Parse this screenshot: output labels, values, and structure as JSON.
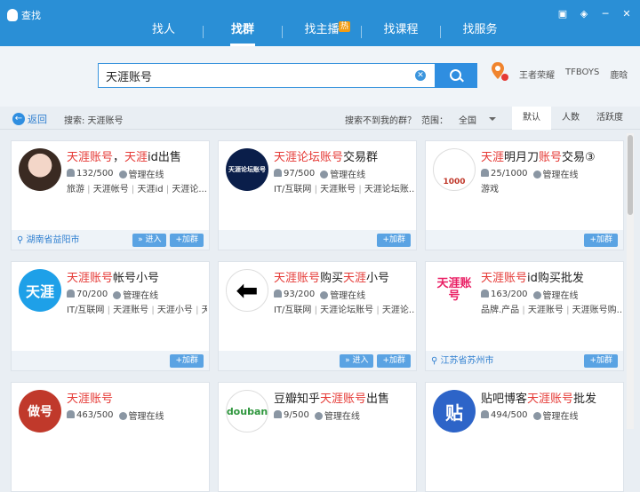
{
  "app": {
    "title": "查找"
  },
  "tabs": [
    {
      "label": "找人"
    },
    {
      "label": "找群"
    },
    {
      "label": "找主播",
      "badge": "热"
    },
    {
      "label": "找课程"
    },
    {
      "label": "找服务"
    }
  ],
  "search": {
    "value": "天涯账号",
    "hot_links": [
      "王者荣耀",
      "TFBOYS",
      "鹿晗"
    ]
  },
  "filter": {
    "back_label": "返回",
    "search_label": "搜索: 天涯账号",
    "notfound_label": "搜索不到我的群？",
    "range_label": "范围：",
    "range_value": "全国",
    "sort": [
      "默认",
      "人数",
      "活跃度"
    ]
  },
  "cards": [
    {
      "title_parts": [
        [
          "天涯账号",
          true
        ],
        [
          "，",
          false
        ],
        [
          "天涯",
          true
        ],
        [
          "id出售",
          false
        ]
      ],
      "members": "132/500",
      "admin": "管理在线",
      "tags": [
        "旅游",
        "天涯帐号",
        "天涯id",
        "天涯论..."
      ],
      "location": "湖南省益阳市",
      "enter": true,
      "avatar": "photo"
    },
    {
      "title_parts": [
        [
          "天涯论坛",
          true
        ],
        [
          "账号",
          true
        ],
        [
          "交易群",
          false
        ]
      ],
      "members": "97/500",
      "admin": "管理在线",
      "tags": [
        "IT/互联网",
        "天涯账号",
        "天涯论坛账..."
      ],
      "location": "",
      "enter": false,
      "avatar": "天涯论坛账号"
    },
    {
      "title_parts": [
        [
          "天涯",
          true
        ],
        [
          "明月刀",
          false
        ],
        [
          "账号",
          true
        ],
        [
          "交易③",
          false
        ]
      ],
      "members": "25/1000",
      "admin": "管理在线",
      "tags": [
        "游戏"
      ],
      "location": "",
      "enter": false,
      "avatar": "1000"
    },
    {
      "title_parts": [
        [
          "天涯账号",
          true
        ],
        [
          "帐号小号",
          false
        ]
      ],
      "members": "70/200",
      "admin": "管理在线",
      "tags": [
        "IT/互联网",
        "天涯账号",
        "天涯小号",
        "天涯..."
      ],
      "location": "",
      "enter": false,
      "avatar": "天涯"
    },
    {
      "title_parts": [
        [
          "天涯账号",
          true
        ],
        [
          "购买",
          false
        ],
        [
          "天涯",
          true
        ],
        [
          "小号",
          false
        ]
      ],
      "members": "93/200",
      "admin": "管理在线",
      "tags": [
        "IT/互联网",
        "天涯论坛账号",
        "天涯论..."
      ],
      "location": "",
      "enter": true,
      "avatar": "arrow"
    },
    {
      "title_parts": [
        [
          "天涯账号",
          true
        ],
        [
          "id购买批发",
          false
        ]
      ],
      "members": "163/200",
      "admin": "管理在线",
      "tags": [
        "品牌.产品",
        "天涯账号",
        "天涯账号购..."
      ],
      "location": "江苏省苏州市",
      "enter": false,
      "avatar": "天涯账号"
    },
    {
      "title_parts": [
        [
          "天涯账号",
          true
        ]
      ],
      "members": "463/500",
      "admin": "管理在线",
      "tags": [],
      "location": "",
      "enter": false,
      "avatar": "做号"
    },
    {
      "title_parts": [
        [
          "豆瓣知乎",
          false
        ],
        [
          "天涯账号",
          true
        ],
        [
          "出售",
          false
        ]
      ],
      "members": "9/500",
      "admin": "管理在线",
      "tags": [],
      "location": "",
      "enter": false,
      "avatar": "douban"
    },
    {
      "title_parts": [
        [
          "贴吧博客",
          false
        ],
        [
          "天涯账号",
          true
        ],
        [
          "批发",
          false
        ]
      ],
      "members": "494/500",
      "admin": "管理在线",
      "tags": [],
      "location": "",
      "enter": false,
      "avatar": "贴"
    }
  ],
  "labels": {
    "enter": "» 进入",
    "join": "+加群"
  },
  "colors": {
    "accent": "#2a8fd6",
    "highlight": "#e53935"
  }
}
